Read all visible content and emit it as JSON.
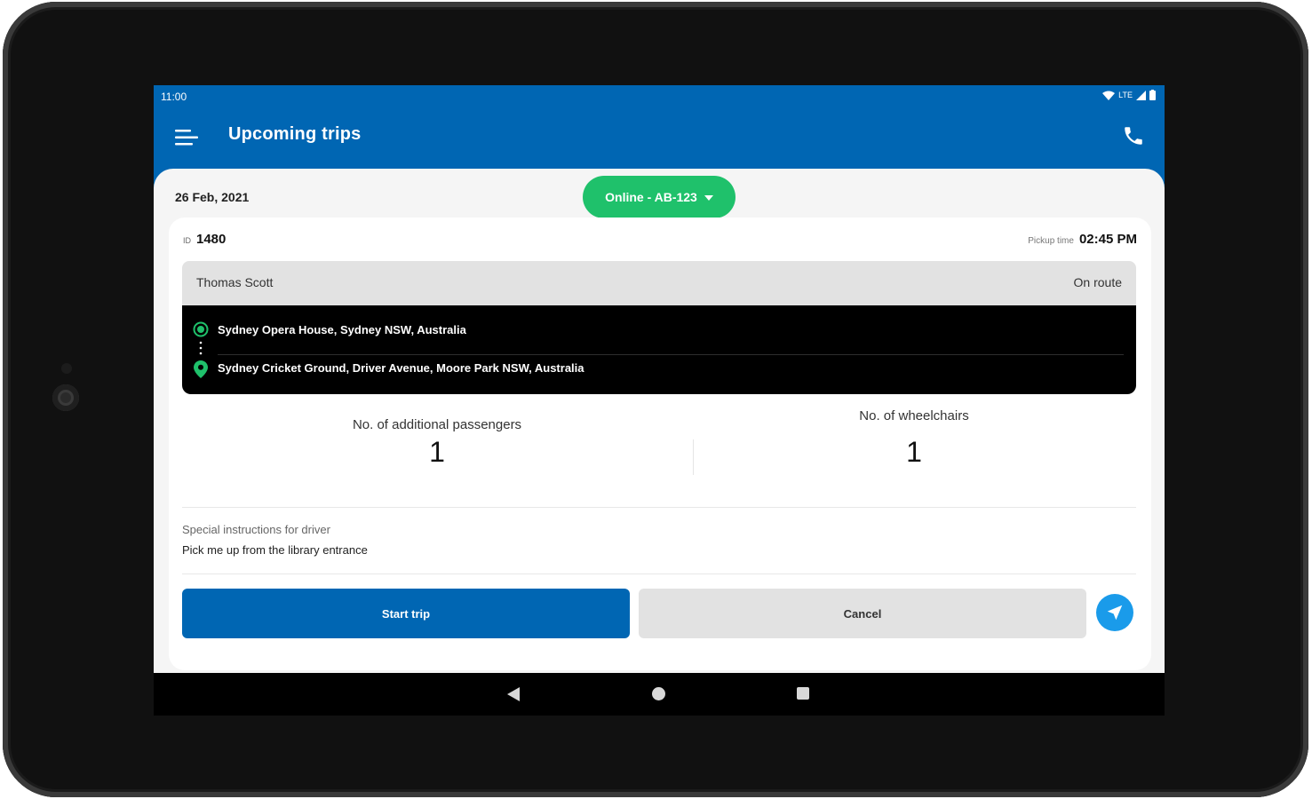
{
  "status_bar": {
    "time": "11:00",
    "network": "LTE"
  },
  "app_bar": {
    "title": "Upcoming trips"
  },
  "header": {
    "date": "26 Feb, 2021",
    "vehicle_status": "Online - AB-123"
  },
  "trip": {
    "id_label": "ID",
    "id": "1480",
    "pickup_time_label": "Pickup time",
    "pickup_time": "02:45 PM",
    "passenger_name": "Thomas Scott",
    "status": "On route",
    "pickup_address": "Sydney Opera House, Sydney NSW, Australia",
    "dropoff_address": "Sydney Cricket Ground, Driver Avenue, Moore Park NSW, Australia",
    "additional_passengers_label": "No. of additional passengers",
    "additional_passengers": "1",
    "wheelchairs_label": "No. of wheelchairs",
    "wheelchairs": "1",
    "instructions_label": "Special instructions for driver",
    "instructions": "Pick me up from the library entrance"
  },
  "actions": {
    "start": "Start trip",
    "cancel": "Cancel"
  },
  "colors": {
    "primary": "#0066b3",
    "online": "#1fc16b",
    "navigate": "#1a9bea"
  }
}
